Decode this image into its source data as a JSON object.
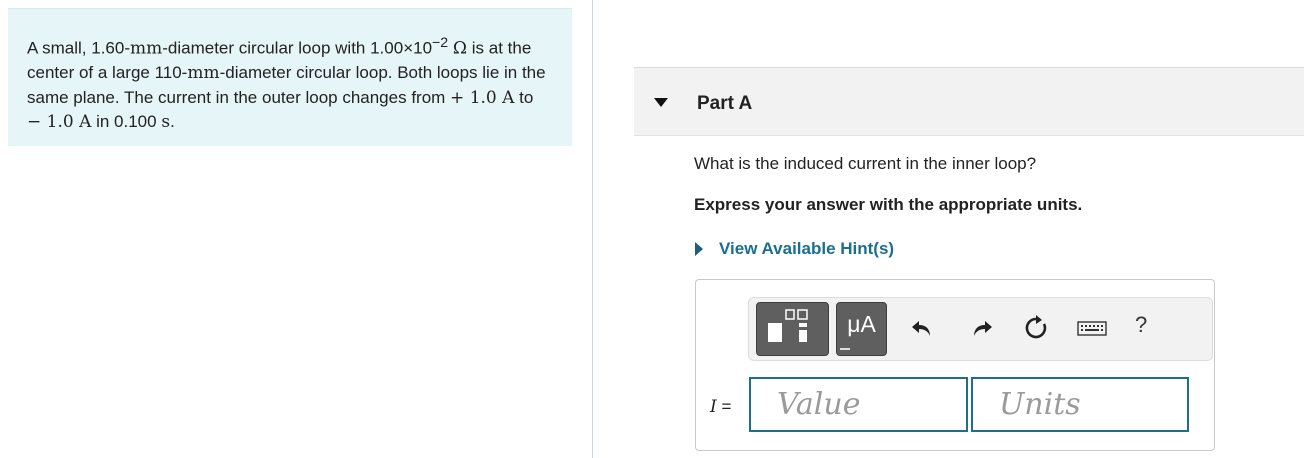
{
  "problem": {
    "text_1": "A small, 1.60-",
    "unit_mm": "mm",
    "text_2": "-diameter circular loop with 1.00×10",
    "exp": "−2",
    "unit_ohm": "Ω",
    "text_3": "is at the center of a large 110-",
    "text_4": "-diameter circular loop. Both loops lie in the same plane. The current in the outer loop changes from ",
    "i_start": "+ 1.0 A",
    "text_5": " to ",
    "i_end": "− 1.0 A",
    "text_6": " in 0.100 ",
    "unit_s": "s",
    "text_7": "."
  },
  "part": {
    "title": "Part A",
    "question": "What is the induced current in the inner loop?",
    "instruction": "Express your answer with the appropriate units.",
    "hint_link": "View Available Hint(s)"
  },
  "toolbar": {
    "units_button_label": "μA",
    "help_label": "?",
    "icons": [
      "templates-icon",
      "units-icon",
      "undo-icon",
      "redo-icon",
      "reset-icon",
      "keyboard-icon",
      "help-icon"
    ]
  },
  "answer": {
    "variable": "I",
    "equals": " =",
    "value_placeholder": "Value",
    "units_placeholder": "Units"
  },
  "colors": {
    "problem_bg": "#e6f5f7",
    "link": "#1a6f8f",
    "field_border": "#1f6e8c",
    "toolbar_button": "#5f5f5f"
  }
}
